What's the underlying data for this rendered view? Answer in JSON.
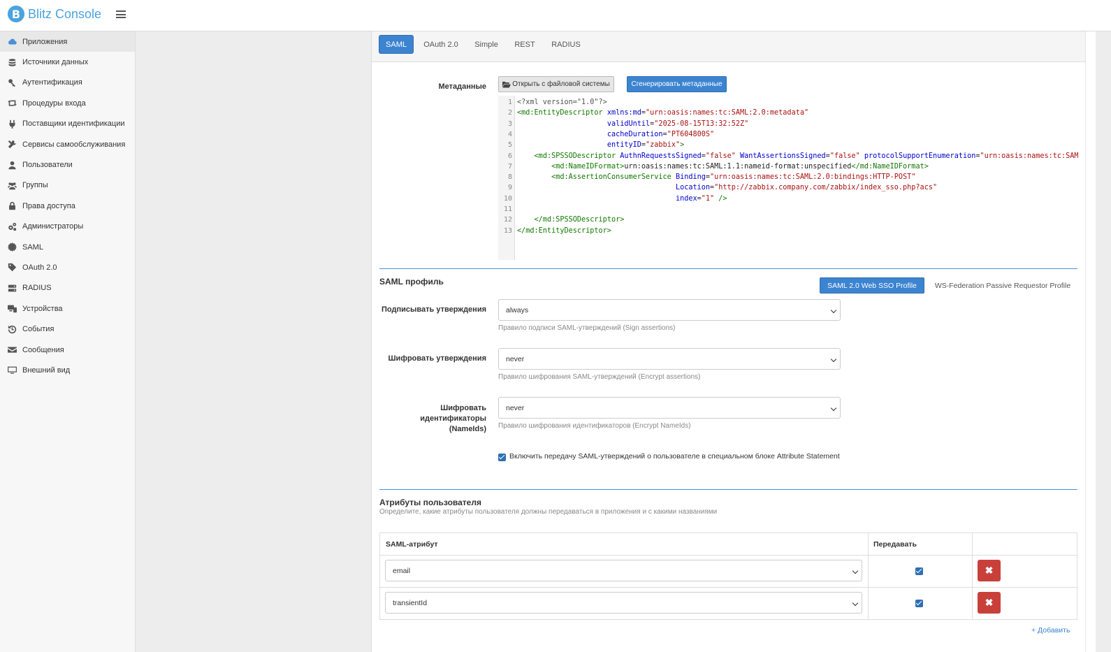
{
  "app": {
    "logo_letter": "B",
    "title": "Blitz Console"
  },
  "sidebar": {
    "items": [
      {
        "label": "Приложения",
        "icon": "cloud-icon"
      },
      {
        "label": "Источники данных",
        "icon": "database-icon"
      },
      {
        "label": "Аутентификация",
        "icon": "key-icon"
      },
      {
        "label": "Процедуры входа",
        "icon": "retweet-icon"
      },
      {
        "label": "Поставщики идентификации",
        "icon": "plug-icon"
      },
      {
        "label": "Сервисы самообслуживания",
        "icon": "tools-icon"
      },
      {
        "label": "Пользователи",
        "icon": "user-icon"
      },
      {
        "label": "Группы",
        "icon": "users-icon"
      },
      {
        "label": "Права доступа",
        "icon": "lock-icon"
      },
      {
        "label": "Администраторы",
        "icon": "cogs-icon"
      },
      {
        "label": "SAML",
        "icon": "certificate-icon"
      },
      {
        "label": "OAuth 2.0",
        "icon": "tag-icon"
      },
      {
        "label": "RADIUS",
        "icon": "server-icon"
      },
      {
        "label": "Устройства",
        "icon": "devices-icon"
      },
      {
        "label": "События",
        "icon": "history-icon"
      },
      {
        "label": "Сообщения",
        "icon": "envelope-icon"
      },
      {
        "label": "Внешний вид",
        "icon": "desktop-icon"
      }
    ]
  },
  "tabs": [
    "SAML",
    "OAuth 2.0",
    "Simple",
    "REST",
    "RADIUS"
  ],
  "metadata": {
    "label": "Метаданные",
    "open_button": "Открыть с файловой системы",
    "generate_button": "Сгенерировать метаданные"
  },
  "saml_profile": {
    "title": "SAML профиль",
    "profile_active": "SAML 2.0 Web SSO Profile",
    "profile_other": "WS-Federation Passive Requestor Profile",
    "sign_label": "Подписывать утверждения",
    "sign_value": "always",
    "sign_hint": "Правило подписи SAML-утверждений (Sign assertions)",
    "encrypt_label": "Шифровать утверждения",
    "encrypt_value": "never",
    "encrypt_hint": "Правило шифрования SAML-утверждений (Encrypt assertions)",
    "encrypt_ids_label_1": "Шифровать идентификаторы",
    "encrypt_ids_label_2": "(NameIds)",
    "encrypt_ids_value": "never",
    "encrypt_ids_hint": "Правило шифрования идентификаторов (Encrypt NameIds)",
    "attr_statement_label": "Включить передачу SAML-утверждений о пользователе в специальном блоке Attribute Statement"
  },
  "attributes": {
    "title": "Атрибуты пользователя",
    "subtitle": "Определите, какие атрибуты пользователя должны передаваться в приложения и с какими названиями",
    "col_attr": "SAML-атрибут",
    "col_send": "Передавать",
    "rows": [
      {
        "value": "email"
      },
      {
        "value": "transientId"
      }
    ],
    "add_link": "+ Добавить"
  }
}
